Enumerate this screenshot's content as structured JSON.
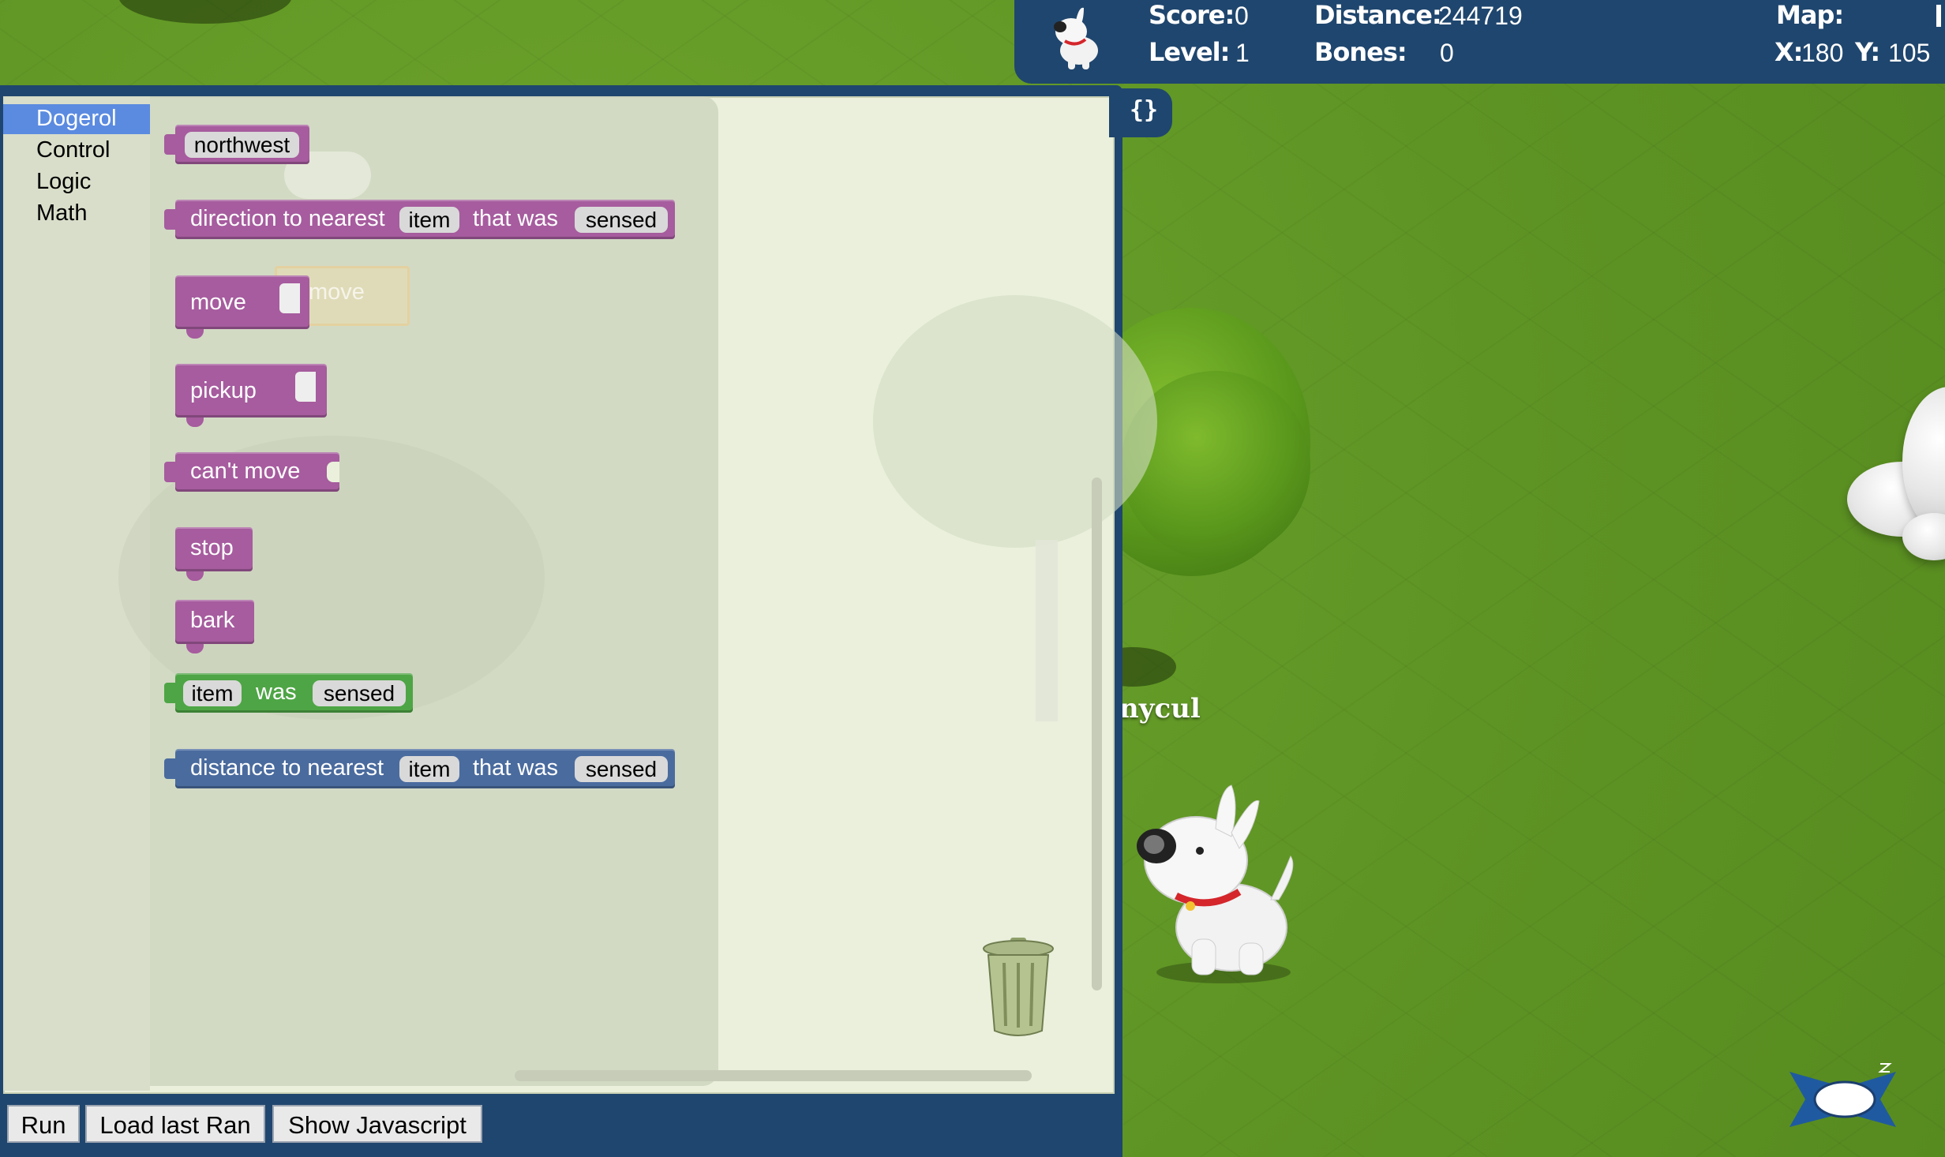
{
  "hud": {
    "score_label": "Score:",
    "score": "0",
    "distance_label": "Distance:",
    "distance": "244719",
    "map_label": "Map:",
    "level_label": "Level:",
    "level": "1",
    "bones_label": "Bones:",
    "bones": "0",
    "x_label": "X:",
    "x": "180",
    "y_label": "Y:",
    "y": "105",
    "icon": "dog-avatar-icon"
  },
  "editor": {
    "categories": [
      "Dogerol",
      "Control",
      "Logic",
      "Math"
    ],
    "selected_category": "Dogerol",
    "code_toggle": "{}",
    "blocks": {
      "northwest": "northwest",
      "direction_prefix": "direction to nearest",
      "direction_field": "item",
      "direction_mid": "that was",
      "direction_field2": "sensed",
      "move": "move",
      "move_ghost": "move",
      "pickup": "pickup",
      "cant_move": "can't move",
      "stop": "stop",
      "bark": "bark",
      "was_field": "item",
      "was_mid": "was",
      "was_field2": "sensed",
      "distance_prefix": "distance to nearest",
      "distance_field": "item",
      "distance_mid": "that was",
      "distance_field2": "sensed"
    },
    "colors": {
      "purple": "#a65c9e",
      "green": "#4ea545",
      "navy": "#4a6b9e"
    }
  },
  "buttons": {
    "run": "Run",
    "load_last": "Load last Ran",
    "show_js": "Show Javascript"
  },
  "player": {
    "name": "nycul"
  }
}
